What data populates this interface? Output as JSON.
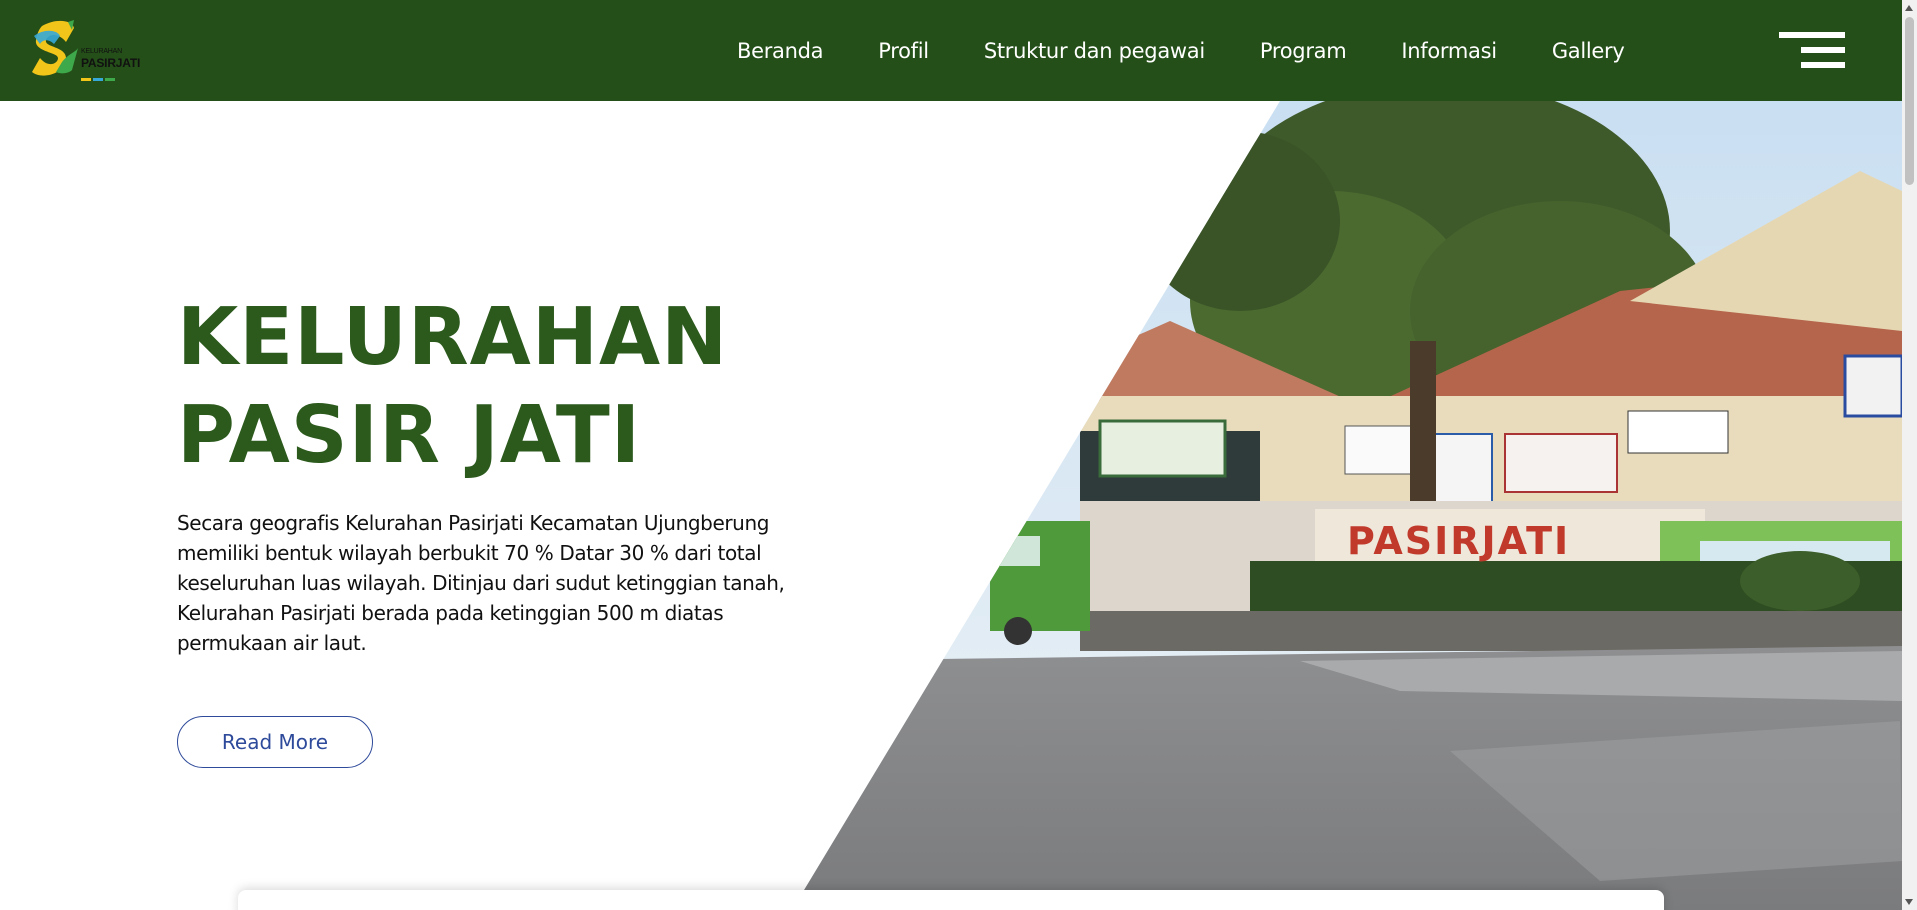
{
  "nav": {
    "logo_lines": [
      "KELURAHAN",
      "PASIRJATI"
    ],
    "links": [
      "Beranda",
      "Profil",
      "Struktur dan pegawai",
      "Program",
      "Informasi",
      "Gallery"
    ],
    "menu_icon": "hamburger-icon"
  },
  "hero": {
    "title_line1": "KELURAHAN",
    "title_line2": "PASIR JATI",
    "description": "Secara geografis Kelurahan Pasirjati Kecamatan Ujungberung memiliki bentuk wilayah berbukit 70 % Datar 30 % dari total keseluruhan luas wilayah. Ditinjau dari sudut ketinggian tanah, Kelurahan Pasirjati berada pada ketinggian 500 m diatas permukaan air laut.",
    "button_label": "Read More",
    "photo_sign_text": "PASIRJATI"
  },
  "colors": {
    "nav_bg": "#244f18",
    "title": "#2b5a1c",
    "button": "#2e4a9a"
  }
}
